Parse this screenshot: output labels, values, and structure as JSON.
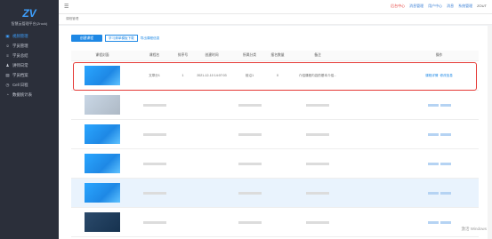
{
  "app": {
    "logo_text": "ZV",
    "brand": "智慧云管理平台(Zrock)"
  },
  "sidebar": {
    "items": [
      {
        "label": "视频管理",
        "icon": "video-icon",
        "active": true
      },
      {
        "label": "学员管理",
        "icon": "user-icon"
      },
      {
        "label": "学员总结",
        "icon": "summary-icon"
      },
      {
        "label": "讲师日常",
        "icon": "teacher-icon"
      },
      {
        "label": "学员档案",
        "icon": "archive-icon"
      },
      {
        "label": "Cell 日程",
        "icon": "calendar-icon"
      },
      {
        "label": "数据统计表",
        "icon": "chart-icon"
      }
    ]
  },
  "topbar": {
    "links": [
      {
        "label": "后台中心",
        "color": "#e53935"
      },
      {
        "label": "消息管理"
      },
      {
        "label": "用户中心"
      },
      {
        "label": "消息"
      },
      {
        "label": "系统管理"
      }
    ],
    "user": "ZOUT"
  },
  "tabbar": {
    "label": "课程管理"
  },
  "actions": {
    "create": "创建课程",
    "import": "学习清单模板下载",
    "link": "导出课程信息"
  },
  "table": {
    "headers": [
      "课程封面",
      "课程名",
      "排序号",
      "创建时间",
      "所属分类",
      "报名数量",
      "备注",
      "",
      "操作"
    ],
    "rows": [
      {
        "name": "文章分1",
        "order": "1",
        "created": "2021-12-10 14:07:03",
        "category": "前沿1",
        "count": "0",
        "note": "介绍课程内容的基本介绍...",
        "ops": [
          "课程详情",
          "修改信息"
        ],
        "thumb": "bright",
        "selected": true
      },
      {
        "name": "",
        "order": "",
        "created": "",
        "category": "",
        "count": "",
        "note": "",
        "ops": [],
        "thumb": "fade"
      },
      {
        "name": "",
        "order": "",
        "created": "",
        "category": "",
        "count": "",
        "note": "",
        "ops": [],
        "thumb": "bright"
      },
      {
        "name": "",
        "order": "",
        "created": "",
        "category": "",
        "count": "",
        "note": "",
        "ops": [],
        "thumb": "bright"
      },
      {
        "name": "",
        "order": "",
        "created": "",
        "category": "",
        "count": "",
        "note": "",
        "ops": [],
        "thumb": "bright",
        "highlight": true
      },
      {
        "name": "",
        "order": "",
        "created": "",
        "category": "",
        "count": "",
        "note": "",
        "ops": [],
        "thumb": "dark"
      }
    ]
  },
  "watermark": "激活 Windows"
}
